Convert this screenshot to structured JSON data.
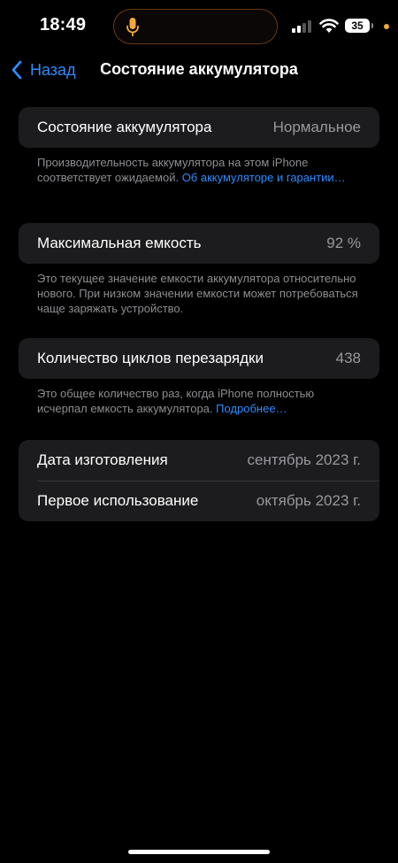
{
  "status_bar": {
    "time": "18:49",
    "battery_level": "35",
    "icons": [
      "mic-icon",
      "cellular-signal-icon",
      "wifi-icon",
      "battery-icon",
      "privacy-dot-icon"
    ],
    "mic_color": "#f2a83b",
    "privacy_dot_color": "#f2a83b"
  },
  "nav": {
    "back_label": "Назад",
    "title": "Состояние аккумулятора"
  },
  "sections": {
    "health": {
      "label": "Состояние аккумулятора",
      "value": "Нормальное",
      "footer_text": "Производительность аккумулятора на этом iPhone соответствует ожидаемой.",
      "footer_link": "Об аккумуляторе и гарантии…"
    },
    "capacity": {
      "label": "Максимальная емкость",
      "value": "92 %",
      "footer_text": "Это текущее значение емкости аккумулятора относительно нового. При низком значении емкости может потребоваться чаще заряжать устройство."
    },
    "cycles": {
      "label": "Количество циклов перезарядки",
      "value": "438",
      "footer_text": "Это общее количество раз, когда iPhone полностью исчерпал емкость аккумулятора.",
      "footer_link": "Подробнее…"
    },
    "dates": {
      "manufacture_label": "Дата изготовления",
      "manufacture_value": "сентябрь 2023 г.",
      "first_use_label": "Первое использование",
      "first_use_value": "октябрь 2023 г."
    }
  },
  "colors": {
    "accent": "#2d8cff",
    "background": "#000000",
    "cell_background": "#1c1c1e"
  }
}
